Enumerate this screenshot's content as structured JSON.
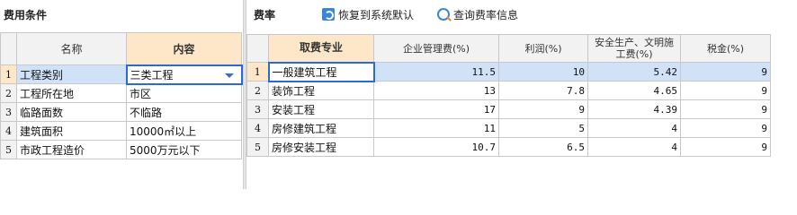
{
  "left": {
    "title": "费用条件",
    "headers": {
      "name": "名称",
      "content": "内容"
    },
    "rows": [
      {
        "num": "1",
        "name": "工程类别",
        "value": "三类工程"
      },
      {
        "num": "2",
        "name": "工程所在地",
        "value": "市区"
      },
      {
        "num": "3",
        "name": "临路面数",
        "value": "不临路"
      },
      {
        "num": "4",
        "name": "建筑面积",
        "value": "10000㎡以上"
      },
      {
        "num": "5",
        "name": "市政工程造价",
        "value": "5000万元以下"
      }
    ]
  },
  "right": {
    "title": "费率",
    "toolbar": {
      "restore_label": "恢复到系统默认",
      "query_label": "查询费率信息"
    },
    "headers": {
      "major": "取费专业",
      "mgmt": "企业管理费(%)",
      "profit": "利润(%)",
      "safety": "安全生产、文明施工费(%)",
      "tax": "税金(%)"
    },
    "rows": [
      {
        "num": "1",
        "major": "一般建筑工程",
        "mgmt": "11.5",
        "profit": "10",
        "safety": "5.42",
        "tax": "9"
      },
      {
        "num": "2",
        "major": "装饰工程",
        "mgmt": "13",
        "profit": "7.8",
        "safety": "4.65",
        "tax": "9"
      },
      {
        "num": "3",
        "major": "安装工程",
        "mgmt": "17",
        "profit": "9",
        "safety": "4.39",
        "tax": "9"
      },
      {
        "num": "4",
        "major": "房修建筑工程",
        "mgmt": "11",
        "profit": "5",
        "safety": "4",
        "tax": "9"
      },
      {
        "num": "5",
        "major": "房修安装工程",
        "mgmt": "10.7",
        "profit": "6.5",
        "safety": "4",
        "tax": "9"
      }
    ]
  },
  "colors": {
    "selection": "#cfe2f8",
    "header_accent": "#fde7c8",
    "border_focus": "#2a6ad4"
  }
}
